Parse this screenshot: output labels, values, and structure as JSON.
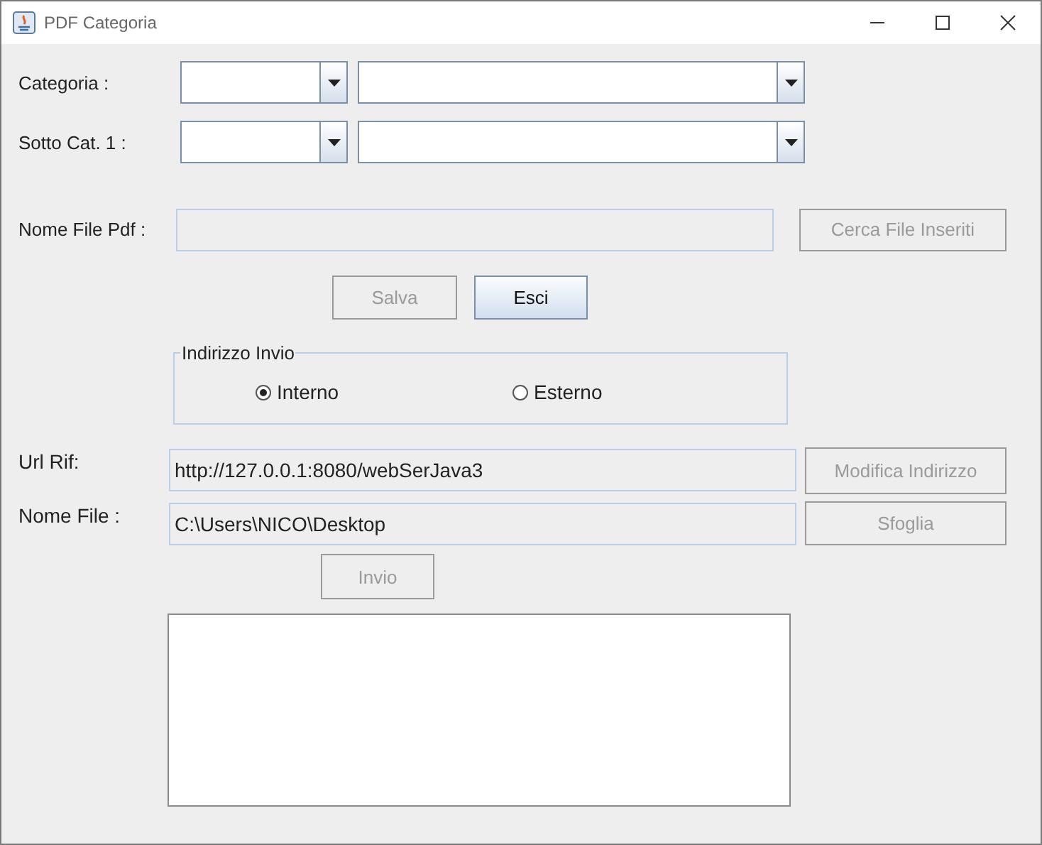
{
  "window": {
    "title": "PDF Categoria"
  },
  "category_rows": [
    {
      "label": "Categoria :",
      "combos": [
        {
          "kind": "narrow"
        },
        {
          "kind": "wide"
        }
      ]
    },
    {
      "label": "Sotto Cat. 1 :",
      "combos": [
        {
          "kind": "narrow"
        },
        {
          "kind": "wide"
        }
      ]
    }
  ],
  "pdf_file": {
    "label": "Nome File Pdf :",
    "disabled": true,
    "button": {
      "label": "Cerca File Inseriti",
      "disabled": true
    }
  },
  "actions": [
    {
      "label": "Salva",
      "disabled": true
    },
    {
      "label": "Esci",
      "disabled": false
    }
  ],
  "send_address": {
    "title": "Indirizzo Invio",
    "options": [
      {
        "label": "Interno",
        "selected": true
      },
      {
        "label": "Esterno",
        "selected": false
      }
    ]
  },
  "url_row": {
    "label": "Url Rif:",
    "value": "http://127.0.0.1:8080/webSerJava3",
    "disabled": true,
    "button": {
      "label": "Modifica Indirizzo",
      "disabled": true
    }
  },
  "file_row": {
    "label": "Nome File :",
    "value": "C:\\Users\\NICO\\Desktop",
    "disabled": true,
    "button": {
      "label": "Sfoglia",
      "disabled": true
    }
  },
  "send_button": {
    "label": "Invio",
    "disabled": true
  }
}
